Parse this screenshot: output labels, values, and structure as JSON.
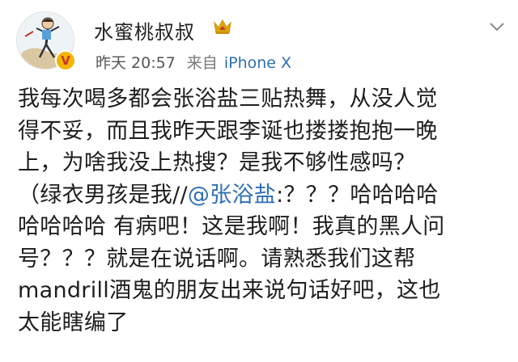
{
  "post": {
    "user_name": "水蜜桃叔叔",
    "vip_badge": "V",
    "time": "昨天 20:57",
    "source_prefix": "来自",
    "device": "iPhone X",
    "lines": [
      "我每次喝多都会张浴盐三贴热舞，从没人觉",
      "得不妥，而且我昨天跟李诞也搂搂抱抱一晚",
      "上，为啥我没上热搜？是我不够性感吗？",
      {
        "before": "（绿衣男孩是我//",
        "mention": "@张浴盐",
        "after": ":？？？哈哈哈哈"
      },
      "哈哈哈哈 有病吧！这是我啊！我真的黑人问",
      "号？？？就是在说话啊。请熟悉我们这帮",
      "mandrill酒鬼的朋友出来说句话好吧，这也",
      "太能瞎编了"
    ]
  },
  "icons": {
    "avatar": "avatar-illustration",
    "crown": "crown-icon",
    "more": "chevron-down-icon"
  },
  "colors": {
    "link": "#2f6fb3",
    "meta": "#7a7a7a",
    "crown": "#e0a800",
    "badge": "#f6b400"
  }
}
